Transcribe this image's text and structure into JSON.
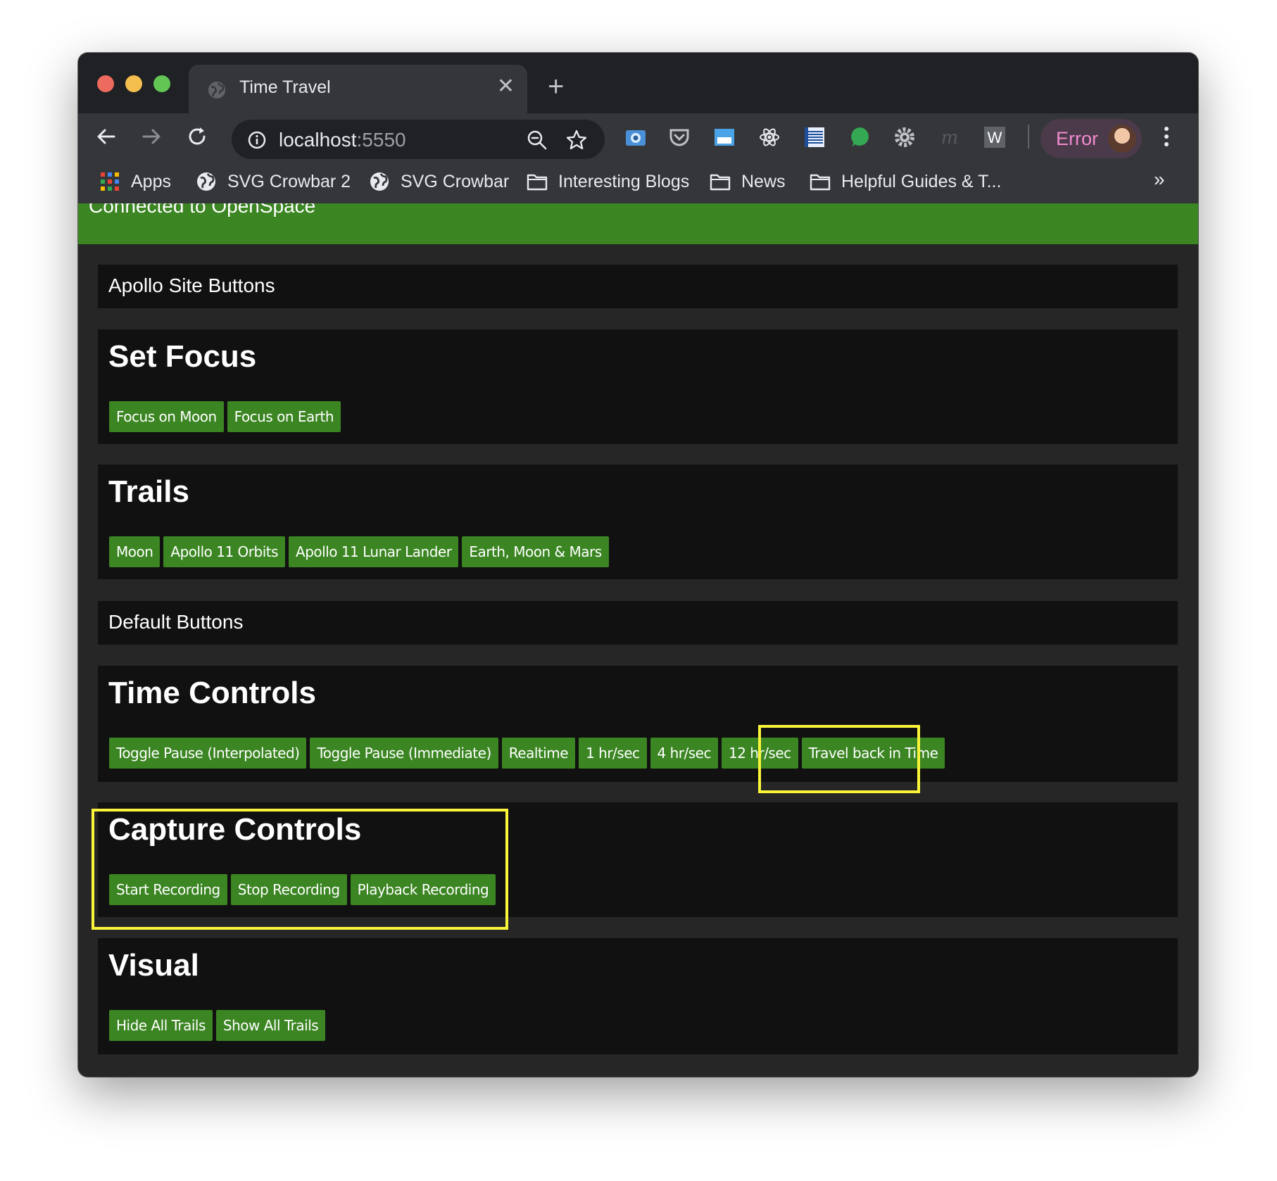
{
  "browser": {
    "tab_title": "Time Travel",
    "tab_close": "✕",
    "new_tab": "+",
    "url_host": "localhost",
    "url_port": ":5550",
    "profile_label": "Error",
    "bookmarks_more": "»",
    "bookmarks": [
      {
        "label": "Apps",
        "icon": "apps-grid-icon"
      },
      {
        "label": "SVG Crowbar 2",
        "icon": "globe-icon"
      },
      {
        "label": "SVG Crowbar",
        "icon": "globe-icon"
      },
      {
        "label": "Interesting Blogs",
        "icon": "folder-icon"
      },
      {
        "label": "News",
        "icon": "folder-icon"
      },
      {
        "label": "Helpful Guides & T...",
        "icon": "folder-icon"
      }
    ],
    "extensions": [
      "camera-extension-icon",
      "pocket-icon",
      "window-extension-icon",
      "react-devtools-icon",
      "wave-extension-icon",
      "chat-bubble-icon",
      "gear-extension-icon",
      "m-extension-icon",
      "w-extension-icon"
    ],
    "extension_w_letter": "W",
    "extension_m_letter": "m"
  },
  "page": {
    "connection_status": "Connected to OpenSpace",
    "sections": [
      {
        "label": "Apollo Site Buttons"
      },
      {
        "title": "Set Focus",
        "buttons": [
          "Focus on Moon",
          "Focus on Earth"
        ]
      },
      {
        "title": "Trails",
        "buttons": [
          "Moon",
          "Apollo 11 Orbits",
          "Apollo 11 Lunar Lander",
          "Earth, Moon & Mars"
        ]
      },
      {
        "label": "Default Buttons"
      },
      {
        "title": "Time Controls",
        "buttons": [
          "Toggle Pause (Interpolated)",
          "Toggle Pause (Immediate)",
          "Realtime",
          "1 hr/sec",
          "4 hr/sec",
          "12 hr/sec",
          "Travel back in Time"
        ]
      },
      {
        "title": "Capture Controls",
        "buttons": [
          "Start Recording",
          "Stop Recording",
          "Playback Recording"
        ]
      },
      {
        "title": "Visual",
        "buttons": [
          "Hide All Trails",
          "Show All Trails"
        ]
      }
    ]
  },
  "colors": {
    "accent_green": "#3b8522",
    "highlight_yellow": "#fbf53a",
    "panel_bg": "#111111",
    "page_bg": "#262626"
  }
}
